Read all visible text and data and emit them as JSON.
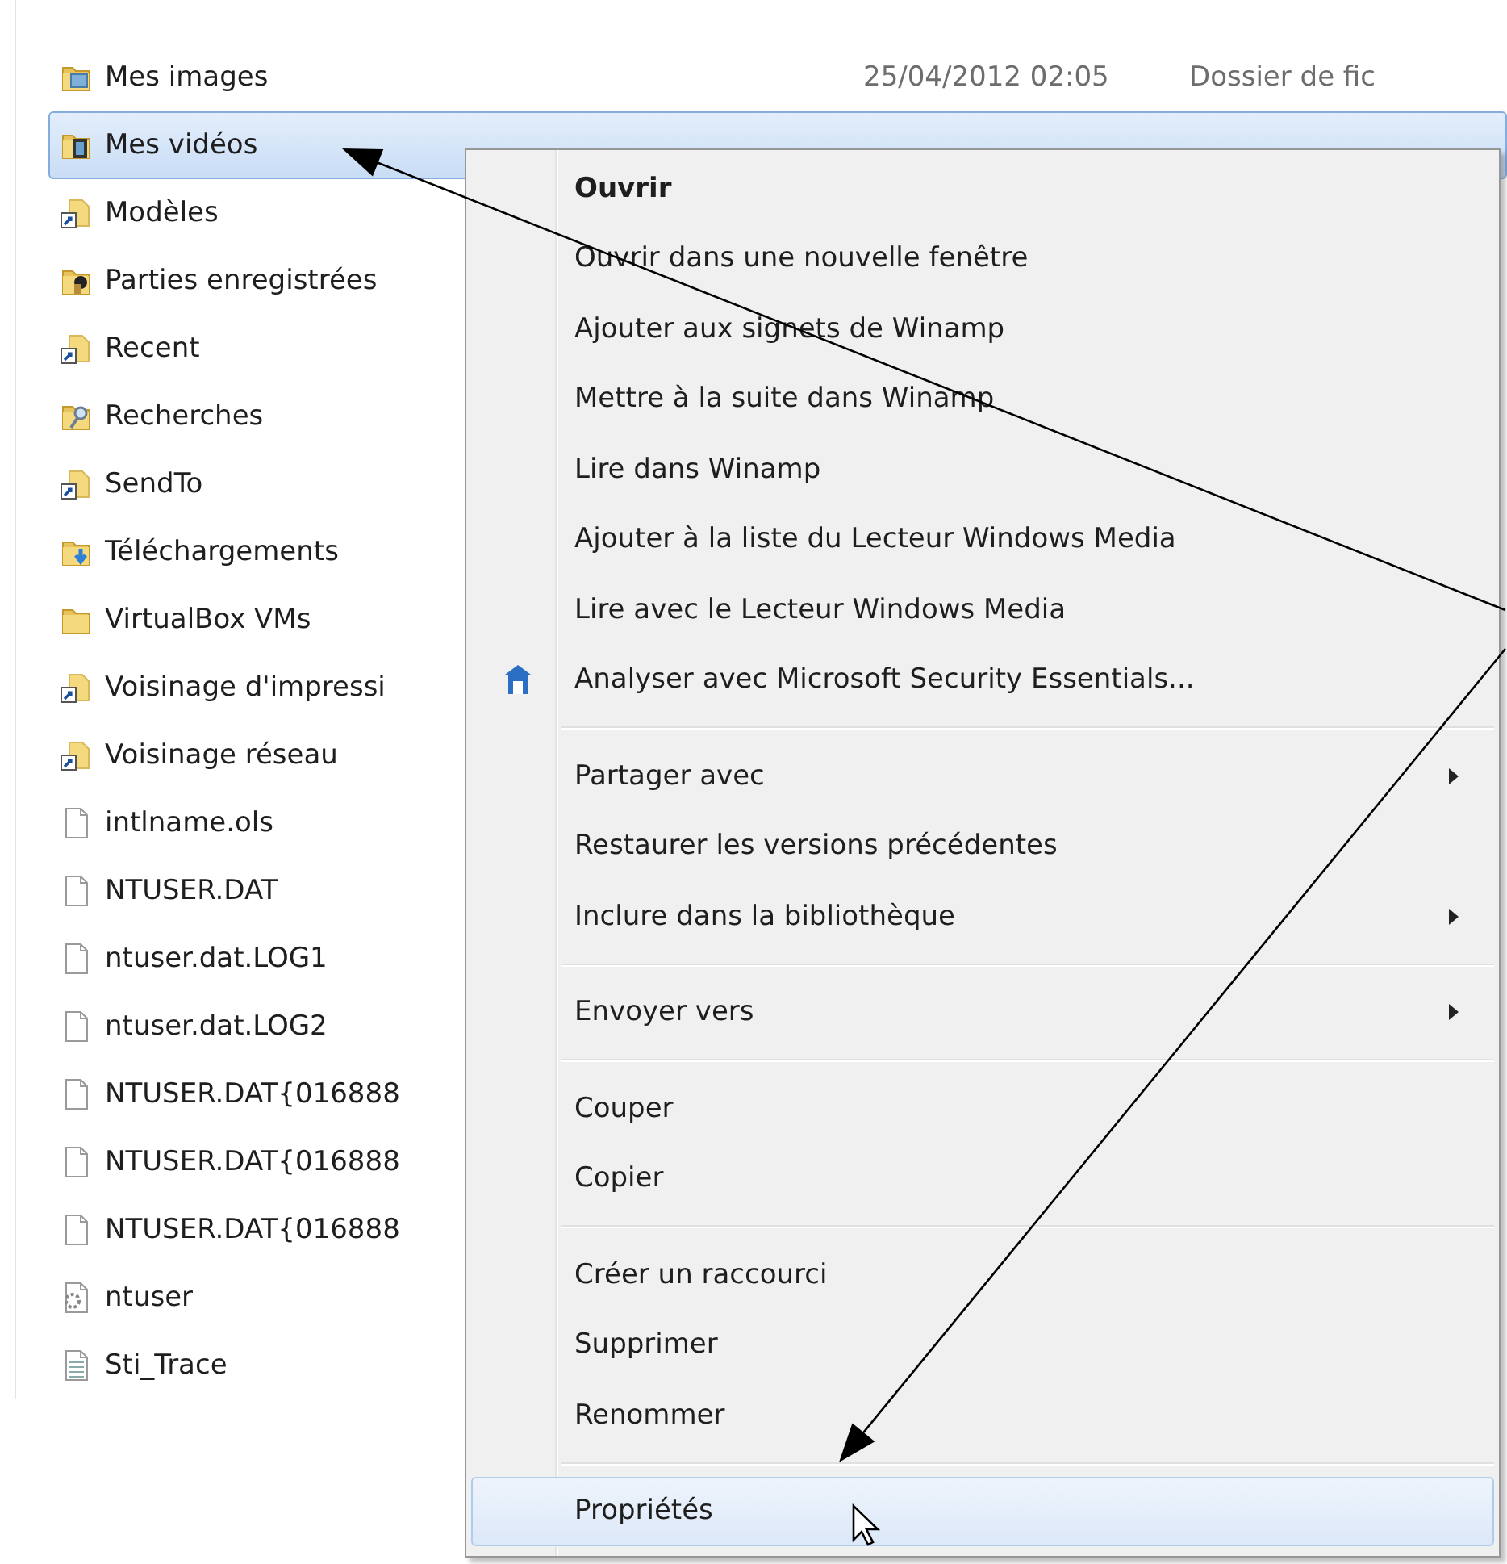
{
  "files": [
    {
      "name": "Mes images",
      "date": "25/04/2012 02:05",
      "type": "Dossier de fic",
      "kind": "folder-images",
      "selected": false
    },
    {
      "name": "Mes vidéos",
      "kind": "folder-videos",
      "selected": true
    },
    {
      "name": "Modèles",
      "kind": "shortcut",
      "selected": false
    },
    {
      "name": "Parties enregistrées",
      "kind": "folder-games",
      "selected": false
    },
    {
      "name": "Recent",
      "kind": "shortcut",
      "selected": false
    },
    {
      "name": "Recherches",
      "kind": "folder-search",
      "selected": false
    },
    {
      "name": "SendTo",
      "kind": "shortcut",
      "selected": false
    },
    {
      "name": "Téléchargements",
      "kind": "folder-downloads",
      "selected": false
    },
    {
      "name": "VirtualBox VMs",
      "kind": "folder",
      "selected": false
    },
    {
      "name": "Voisinage d'impressi",
      "kind": "shortcut",
      "selected": false
    },
    {
      "name": "Voisinage réseau",
      "kind": "shortcut",
      "selected": false
    },
    {
      "name": "intlname.ols",
      "kind": "file",
      "selected": false
    },
    {
      "name": "NTUSER.DAT",
      "kind": "file",
      "selected": false
    },
    {
      "name": "ntuser.dat.LOG1",
      "kind": "file",
      "selected": false
    },
    {
      "name": "ntuser.dat.LOG2",
      "kind": "file",
      "selected": false
    },
    {
      "name": "NTUSER.DAT{016888",
      "kind": "file",
      "selected": false
    },
    {
      "name": "NTUSER.DAT{016888",
      "kind": "file",
      "selected": false
    },
    {
      "name": "NTUSER.DAT{016888",
      "kind": "file",
      "selected": false
    },
    {
      "name": "ntuser",
      "kind": "settings-file",
      "selected": false
    },
    {
      "name": "Sti_Trace",
      "kind": "text-file",
      "selected": false
    }
  ],
  "context_menu": [
    {
      "kind": "item",
      "label": "Ouvrir",
      "bold": true,
      "submenu": false,
      "has_icon": false,
      "selected": false
    },
    {
      "kind": "item",
      "label": "Ouvrir dans une nouvelle fenêtre",
      "bold": false,
      "submenu": false,
      "has_icon": false,
      "selected": false
    },
    {
      "kind": "item",
      "label": "Ajouter aux signets de Winamp",
      "bold": false,
      "submenu": false,
      "has_icon": false,
      "selected": false
    },
    {
      "kind": "item",
      "label": "Mettre à la suite dans Winamp",
      "bold": false,
      "submenu": false,
      "has_icon": false,
      "selected": false
    },
    {
      "kind": "item",
      "label": "Lire dans Winamp",
      "bold": false,
      "submenu": false,
      "has_icon": false,
      "selected": false
    },
    {
      "kind": "item",
      "label": "Ajouter à la liste du Lecteur Windows Media",
      "bold": false,
      "submenu": false,
      "has_icon": false,
      "selected": false
    },
    {
      "kind": "item",
      "label": "Lire avec le Lecteur Windows Media",
      "bold": false,
      "submenu": false,
      "has_icon": false,
      "selected": false
    },
    {
      "kind": "item",
      "label": "Analyser avec Microsoft Security Essentials...",
      "bold": false,
      "submenu": false,
      "has_icon": true,
      "selected": false
    },
    {
      "kind": "separator"
    },
    {
      "kind": "item",
      "label": "Partager avec",
      "bold": false,
      "submenu": true,
      "has_icon": false,
      "selected": false
    },
    {
      "kind": "item",
      "label": "Restaurer les versions précédentes",
      "bold": false,
      "submenu": false,
      "has_icon": false,
      "selected": false
    },
    {
      "kind": "item",
      "label": "Inclure dans la bibliothèque",
      "bold": false,
      "submenu": true,
      "has_icon": false,
      "selected": false
    },
    {
      "kind": "separator"
    },
    {
      "kind": "item",
      "label": "Envoyer vers",
      "bold": false,
      "submenu": true,
      "has_icon": false,
      "selected": false
    },
    {
      "kind": "separator"
    },
    {
      "kind": "item",
      "label": "Couper",
      "bold": false,
      "submenu": false,
      "has_icon": false,
      "selected": false
    },
    {
      "kind": "item",
      "label": "Copier",
      "bold": false,
      "submenu": false,
      "has_icon": false,
      "selected": false
    },
    {
      "kind": "separator"
    },
    {
      "kind": "item",
      "label": "Créer un raccourci",
      "bold": false,
      "submenu": false,
      "has_icon": false,
      "selected": false
    },
    {
      "kind": "item",
      "label": "Supprimer",
      "bold": false,
      "submenu": false,
      "has_icon": false,
      "selected": false
    },
    {
      "kind": "item",
      "label": "Renommer",
      "bold": false,
      "submenu": false,
      "has_icon": false,
      "selected": false
    },
    {
      "kind": "separator"
    },
    {
      "kind": "item",
      "label": "Propriétés",
      "bold": false,
      "submenu": false,
      "has_icon": false,
      "selected": true
    }
  ]
}
